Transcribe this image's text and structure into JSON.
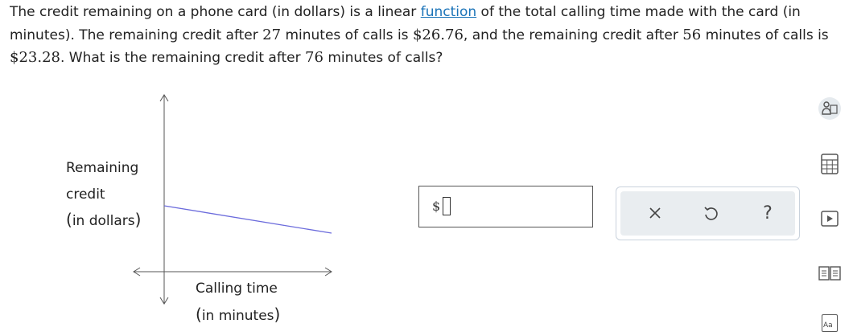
{
  "question": {
    "part1": "The credit remaining on a phone card (in dollars) is a linear ",
    "link_text": "function",
    "part2": " of the total calling time made with the card (in",
    "part3": "minutes). The remaining credit after ",
    "minutes1": "27",
    "part4": " minutes of calls is ",
    "credit1": "$26.76",
    "part5": ", and the remaining credit after ",
    "minutes2": "56",
    "part6": " minutes of calls is",
    "credit2": "$23.28",
    "part7": ". What is the remaining credit after ",
    "minutes3": "76",
    "part8": " minutes of calls?"
  },
  "graph": {
    "y_label_line1": "Remaining",
    "y_label_line2": "credit",
    "y_label_unit_open": "(",
    "y_label_unit": "in dollars",
    "y_label_unit_close": ")",
    "x_label_line1": "Calling time",
    "x_label_unit_open": "(",
    "x_label_unit": "in minutes",
    "x_label_unit_close": ")",
    "line_color": "#6b6bdc"
  },
  "answer": {
    "prefix": "$",
    "value": ""
  },
  "toolbar": {
    "clear_icon": "x-icon",
    "undo_icon": "undo-icon",
    "help_label": "?"
  },
  "side_tools": [
    {
      "icon": "person-explain-icon"
    },
    {
      "icon": "calculator-icon"
    },
    {
      "icon": "video-play-icon"
    },
    {
      "icon": "textbook-icon"
    },
    {
      "icon": "glossary-icon",
      "label": "Aa"
    }
  ]
}
